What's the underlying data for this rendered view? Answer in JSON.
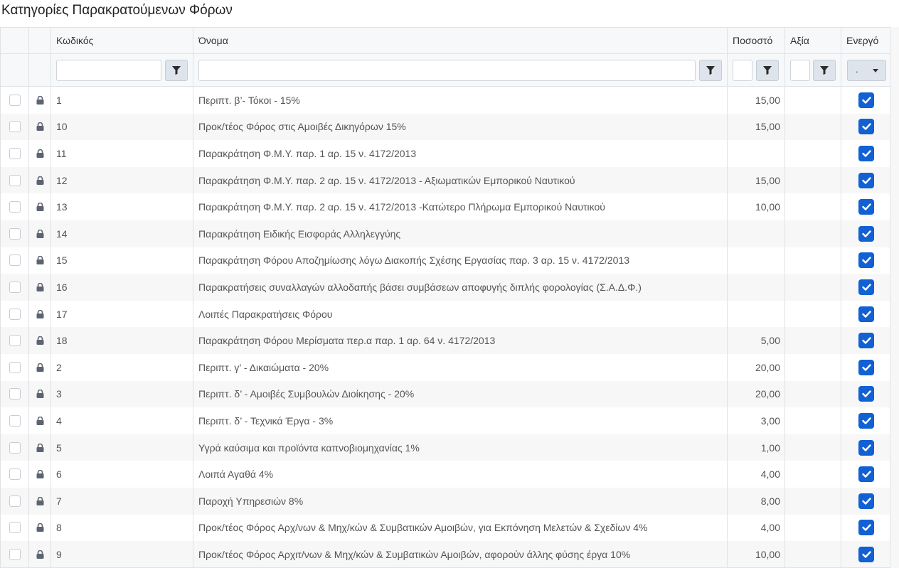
{
  "page": {
    "title": "Κατηγορίες Παρακρατούμενων Φόρων"
  },
  "columns": {
    "code": "Κωδικός",
    "name": "Όνομα",
    "rate": "Ποσοστό",
    "value": "Αξία",
    "active": "Ενεργό"
  },
  "filters": {
    "code_value": "",
    "name_value": "",
    "rate_value": "",
    "value_value": "",
    "active_selected": "."
  },
  "icons": {
    "filter": "filter-funnel-icon",
    "lock": "lock-icon",
    "check": "checkmark-icon",
    "dropdown": "chevron-down-icon"
  },
  "colors": {
    "accent": "#1160d4",
    "border": "#dfe2e6",
    "header_bg": "#f7f8fa",
    "stripe_bg": "#f7f7f7"
  },
  "rows": [
    {
      "code": "1",
      "name": "Περιπτ. β’- Τόκοι - 15%",
      "rate": "15,00",
      "value": "",
      "active": true
    },
    {
      "code": "10",
      "name": "Προκ/τέος Φόρος στις Αμοιβές Δικηγόρων 15%",
      "rate": "15,00",
      "value": "",
      "active": true
    },
    {
      "code": "11",
      "name": "Παρακράτηση Φ.Μ.Υ. παρ. 1 αρ. 15 ν. 4172/2013",
      "rate": "",
      "value": "",
      "active": true
    },
    {
      "code": "12",
      "name": "Παρακράτηση Φ.Μ.Υ. παρ. 2 αρ. 15 ν. 4172/2013 - Αξιωματικών Εμπορικού Ναυτικού",
      "rate": "15,00",
      "value": "",
      "active": true
    },
    {
      "code": "13",
      "name": "Παρακράτηση Φ.Μ.Υ. παρ. 2 αρ. 15 ν. 4172/2013 -Κατώτερο Πλήρωμα Εμπορικού Ναυτικού",
      "rate": "10,00",
      "value": "",
      "active": true
    },
    {
      "code": "14",
      "name": "Παρακράτηση Ειδικής Εισφοράς Αλληλεγγύης",
      "rate": "",
      "value": "",
      "active": true
    },
    {
      "code": "15",
      "name": "Παρακράτηση Φόρου Αποζημίωσης λόγω Διακοπής Σχέσης Εργασίας παρ. 3 αρ. 15 ν. 4172/2013",
      "rate": "",
      "value": "",
      "active": true
    },
    {
      "code": "16",
      "name": "Παρακρατήσεις συναλλαγών αλλοδαπής βάσει συμβάσεων αποφυγής διπλής φορολογίας (Σ.Α.Δ.Φ.)",
      "rate": "",
      "value": "",
      "active": true
    },
    {
      "code": "17",
      "name": "Λοιπές Παρακρατήσεις Φόρου",
      "rate": "",
      "value": "",
      "active": true
    },
    {
      "code": "18",
      "name": "Παρακράτηση Φόρου Μερίσματα περ.α παρ. 1 αρ. 64 ν. 4172/2013",
      "rate": "5,00",
      "value": "",
      "active": true
    },
    {
      "code": "2",
      "name": "Περιπτ. γ’ - Δικαιώματα - 20%",
      "rate": "20,00",
      "value": "",
      "active": true
    },
    {
      "code": "3",
      "name": "Περιπτ. δ’ - Αμοιβές Συμβουλών Διοίκησης - 20%",
      "rate": "20,00",
      "value": "",
      "active": true
    },
    {
      "code": "4",
      "name": "Περιπτ. δ’ - Τεχνικά Έργα - 3%",
      "rate": "3,00",
      "value": "",
      "active": true
    },
    {
      "code": "5",
      "name": "Υγρά καύσιμα και προϊόντα καπνοβιομηχανίας 1%",
      "rate": "1,00",
      "value": "",
      "active": true
    },
    {
      "code": "6",
      "name": "Λοιπά Αγαθά 4%",
      "rate": "4,00",
      "value": "",
      "active": true
    },
    {
      "code": "7",
      "name": "Παροχή Υπηρεσιών 8%",
      "rate": "8,00",
      "value": "",
      "active": true
    },
    {
      "code": "8",
      "name": "Προκ/τέος Φόρος Αρχ/νων & Μηχ/κών & Συμβατικών Αμοιβών, για Εκπόνηση Μελετών & Σχεδίων 4%",
      "rate": "4,00",
      "value": "",
      "active": true
    },
    {
      "code": "9",
      "name": "Προκ/τέος Φόρος Αρχιτ/νων & Μηχ/κών & Συμβατικών Αμοιβών, αφορούν άλλης φύσης έργα 10%",
      "rate": "10,00",
      "value": "",
      "active": true
    }
  ]
}
